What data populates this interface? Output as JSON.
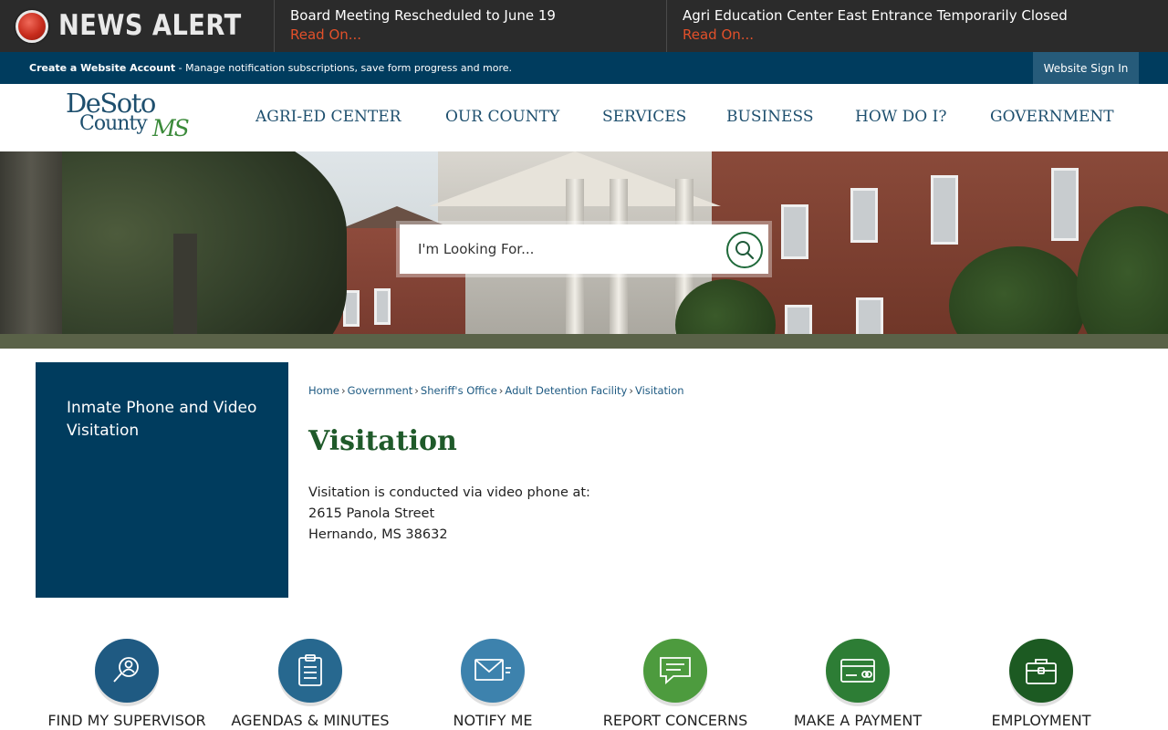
{
  "alert": {
    "title": "NEWS ALERT",
    "items": [
      {
        "title": "Board Meeting Rescheduled to June 19",
        "link": "Read On..."
      },
      {
        "title": "Agri Education Center East Entrance Temporarily Closed",
        "link": "Read On..."
      }
    ]
  },
  "account": {
    "create_label": "Create a Website Account",
    "description": " - Manage notification subscriptions, save form progress and more.",
    "signin_label": "Website Sign In"
  },
  "logo": {
    "line1": "DeSoto",
    "line2": "County",
    "suffix": "MS"
  },
  "nav": {
    "items": [
      "AGRI-ED CENTER",
      "OUR COUNTY",
      "SERVICES",
      "BUSINESS",
      "HOW DO I?",
      "GOVERNMENT"
    ]
  },
  "search": {
    "placeholder": "I'm Looking For..."
  },
  "sidebar": {
    "link": "Inmate Phone and Video Visitation"
  },
  "breadcrumb": [
    "Home",
    "Government",
    "Sheriff's Office",
    "Adult Detention Facility",
    "Visitation"
  ],
  "page": {
    "title": "Visitation",
    "lines": [
      "Visitation is conducted via video phone at:",
      "2615 Panola Street",
      "Hernando, MS 38632"
    ]
  },
  "quick_links": [
    {
      "label": "FIND MY SUPERVISOR",
      "icon": "supervisor-icon",
      "color": "#1f5a82"
    },
    {
      "label": "AGENDAS & MINUTES",
      "icon": "clipboard-icon",
      "color": "#27688f"
    },
    {
      "label": "NOTIFY ME",
      "icon": "envelope-icon",
      "color": "#3d82ad"
    },
    {
      "label": "REPORT CONCERNS",
      "icon": "chat-icon",
      "color": "#4d9b3e"
    },
    {
      "label": "MAKE A PAYMENT",
      "icon": "credit-card-icon",
      "color": "#2d7d35"
    },
    {
      "label": "EMPLOYMENT",
      "icon": "briefcase-icon",
      "color": "#1c5a22"
    }
  ],
  "colors": {
    "navy": "#003c5e",
    "alert_red": "#e2502a",
    "title_green": "#1f5a2a"
  }
}
